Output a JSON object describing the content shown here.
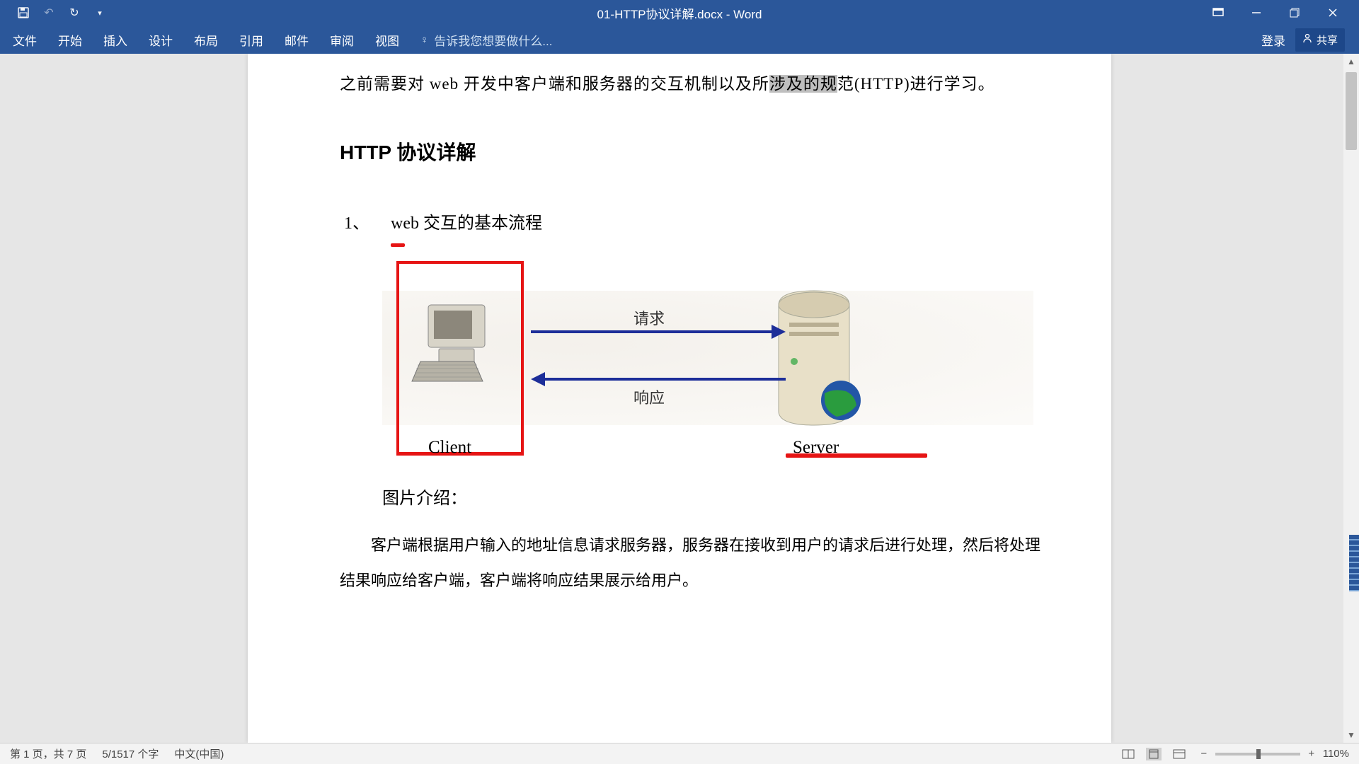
{
  "titlebar": {
    "doc_title": "01-HTTP协议详解.docx - Word"
  },
  "ribbon": {
    "tabs": [
      "文件",
      "开始",
      "插入",
      "设计",
      "布局",
      "引用",
      "邮件",
      "审阅",
      "视图"
    ],
    "tell_me_placeholder": "告诉我您想要做什么...",
    "login_label": "登录",
    "share_label": "共享"
  },
  "document": {
    "intro_before": "之前需要对 web 开发中客户端和服务器的交互机制以及所",
    "intro_highlight": "涉及的规",
    "intro_after": "范(HTTP)进行学习。",
    "heading": "HTTP 协议详解",
    "section_1_num": "1、",
    "section_1_title": "web 交互的基本流程",
    "diagram": {
      "client_label": "Client",
      "server_label": "Server",
      "request_label": "请求",
      "response_label": "响应"
    },
    "subhead": "图片介绍：",
    "body": "客户端根据用户输入的地址信息请求服务器，服务器在接收到用户的请求后进行处理，然后将处理结果响应给客户端，客户端将响应结果展示给用户。"
  },
  "statusbar": {
    "page_info": "第 1 页，共 7 页",
    "word_count": "5/1517 个字",
    "language": "中文(中国)",
    "zoom": "110%"
  }
}
